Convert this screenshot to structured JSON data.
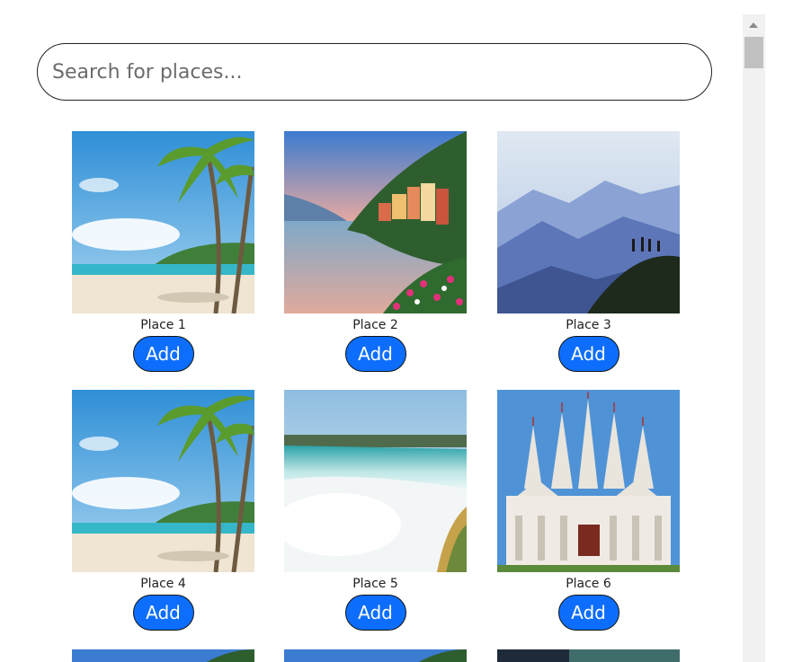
{
  "search": {
    "placeholder": "Search for places..."
  },
  "places": [
    {
      "name": "Place 1",
      "add_label": "Add",
      "image": "tropical-beach-palms"
    },
    {
      "name": "Place 2",
      "add_label": "Add",
      "image": "lakeside-village"
    },
    {
      "name": "Place 3",
      "add_label": "Add",
      "image": "misty-mountains-hikers"
    },
    {
      "name": "Place 4",
      "add_label": "Add",
      "image": "tropical-beach-palms"
    },
    {
      "name": "Place 5",
      "add_label": "Add",
      "image": "waterfall"
    },
    {
      "name": "Place 6",
      "add_label": "Add",
      "image": "white-temple"
    }
  ],
  "colors": {
    "button_bg": "#0d6efd",
    "button_text": "#ffffff"
  }
}
